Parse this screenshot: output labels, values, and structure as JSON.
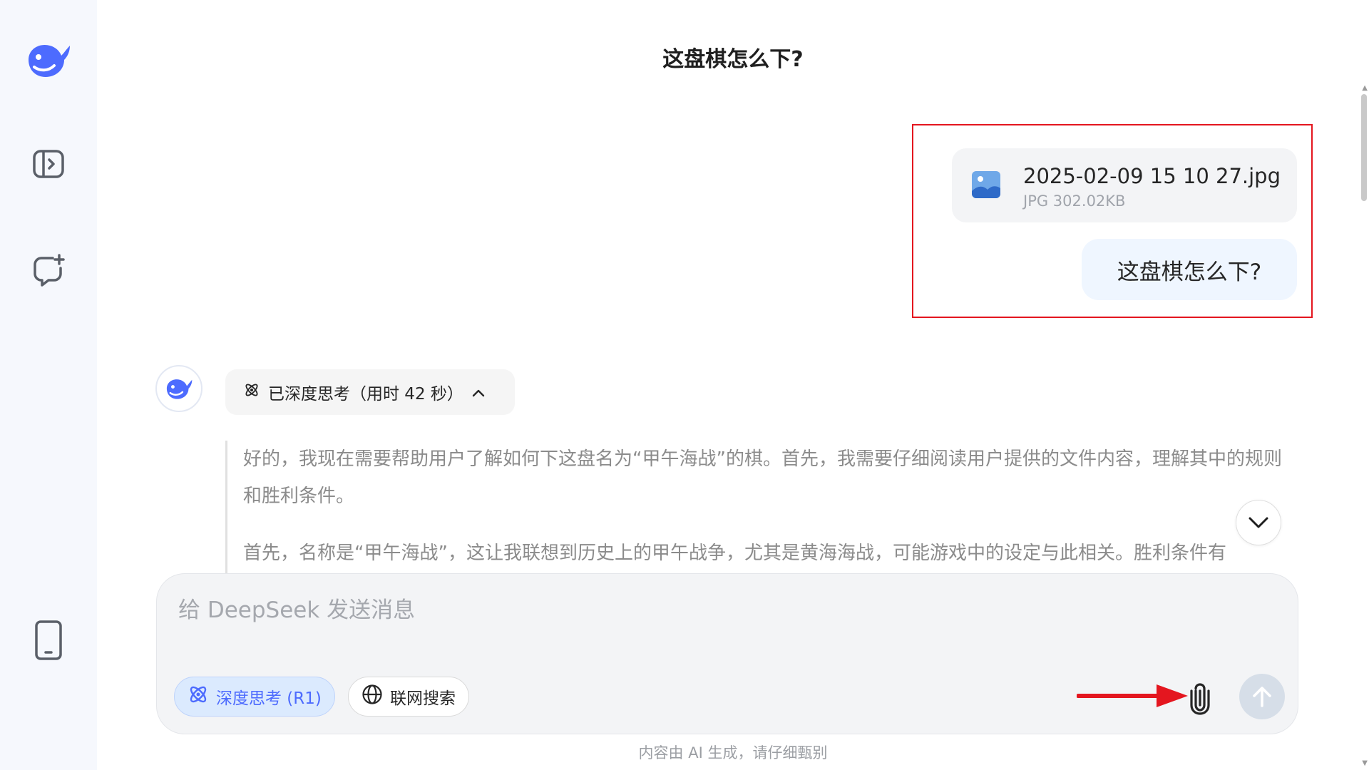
{
  "conversation": {
    "title": "这盘棋怎么下?"
  },
  "sidebar": {
    "logo_icon": "deepseek-whale-logo",
    "items": [
      {
        "name": "open-sidebar",
        "icon": "sidebar-toggle-icon"
      },
      {
        "name": "new-chat",
        "icon": "new-chat-icon"
      },
      {
        "name": "mobile-app",
        "icon": "phone-icon"
      }
    ]
  },
  "user_message": {
    "attachment": {
      "filename": "2025-02-09 15 10 27.jpg",
      "meta": "JPG 302.02KB",
      "icon": "image-file-icon"
    },
    "text": "这盘棋怎么下?"
  },
  "assistant": {
    "avatar_icon": "deepseek-whale-logo",
    "thinking_label": "已深度思考（用时 42 秒）",
    "reasoning": [
      "好的，我现在需要帮助用户了解如何下这盘名为“甲午海战”的棋。首先，我需要仔细阅读用户提供的文件内容，理解其中的规则和胜利条件。",
      "首先，名称是“甲午海战”，这让我联想到历史上的甲午战争，尤其是黄海海战，可能游戏中的设定与此相关。胜利条件有"
    ]
  },
  "composer": {
    "placeholder": "给 DeepSeek 发送消息",
    "value": "",
    "deep_think_label": "深度思考 (R1)",
    "web_search_label": "联网搜索"
  },
  "footer": {
    "disclaimer": "内容由 AI 生成，请仔细甄别"
  },
  "colors": {
    "accent": "#4d6bfe",
    "highlight_box": "#e4161f",
    "annotation_arrow": "#e4161f"
  }
}
